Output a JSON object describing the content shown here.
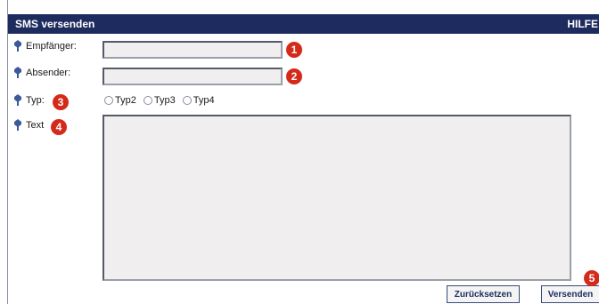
{
  "window": {
    "title": "SMS versenden",
    "help": "HILFE"
  },
  "fields": [
    {
      "label": "Empfänger:",
      "value": "",
      "badge": "1"
    },
    {
      "label": "Absender:",
      "value": "",
      "badge": "2"
    }
  ],
  "type_field": {
    "label": "Typ:",
    "badge": "3",
    "options": [
      "Typ2",
      "Typ3",
      "Typ4"
    ]
  },
  "text_field": {
    "label": "Text",
    "value": "",
    "badge": "4"
  },
  "buttons": {
    "reset": "Zurücksetzen",
    "send": "Versenden",
    "badge": "5"
  },
  "colors": {
    "titlebar": "#1d2b5e",
    "badge": "#d42a1a",
    "pin": "#3c5a9a"
  }
}
